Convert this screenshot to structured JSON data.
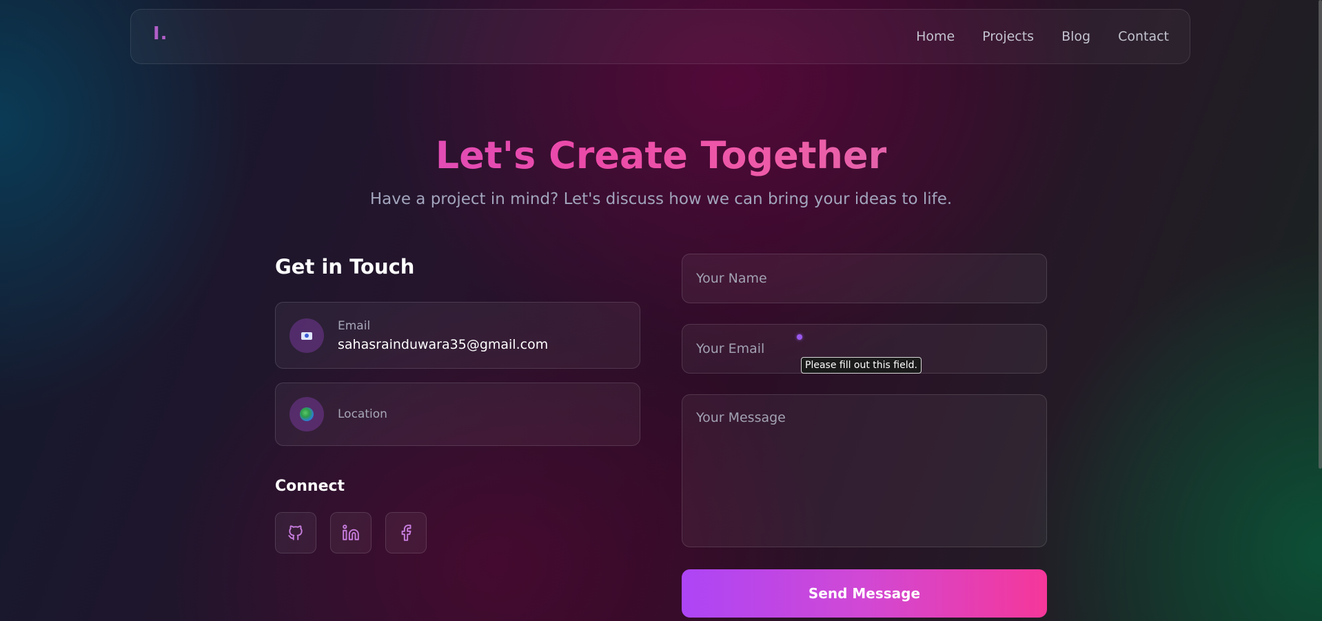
{
  "nav": {
    "logo": "I.",
    "links": [
      "Home",
      "Projects",
      "Blog",
      "Contact"
    ]
  },
  "hero": {
    "title": "Let's Create Together",
    "subtitle": "Have a project in mind? Let's discuss how we can bring your ideas to life."
  },
  "contact": {
    "heading": "Get in Touch",
    "email": {
      "label": "Email",
      "value": "sahasrainduwara35@gmail.com",
      "icon": "envelope-icon"
    },
    "location": {
      "label": "Location",
      "icon": "globe-icon"
    },
    "connect_heading": "Connect",
    "socials": [
      {
        "name": "github",
        "icon": "github-icon"
      },
      {
        "name": "linkedin",
        "icon": "linkedin-icon"
      },
      {
        "name": "facebook",
        "icon": "facebook-icon"
      }
    ]
  },
  "form": {
    "name_placeholder": "Your Name",
    "email_placeholder": "Your Email",
    "message_placeholder": "Your Message",
    "validation_tooltip": "Please fill out this field.",
    "submit_label": "Send Message"
  },
  "colors": {
    "accent_purple": "#ad45f6",
    "accent_pink": "#f5379a",
    "icon_stroke": "#c77dde"
  }
}
